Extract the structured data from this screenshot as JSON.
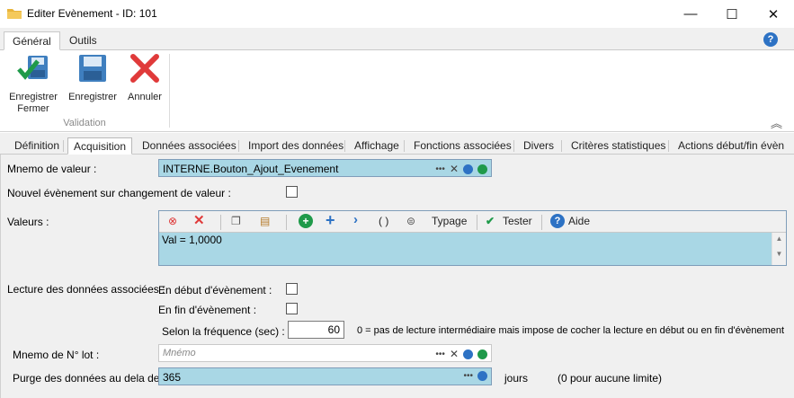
{
  "window": {
    "title": "Editer Evènement - ID: 101",
    "minimize": "—",
    "maximize": "☐",
    "close": "✕"
  },
  "ribbon_tabs": [
    "Général",
    "Outils"
  ],
  "ribbon": {
    "save_close": "Enregistrer\nFermer",
    "save": "Enregistrer",
    "cancel": "Annuler",
    "group": "Validation"
  },
  "tabs": [
    "Définition",
    "Acquisition",
    "Données associées",
    "Import des données",
    "Affichage",
    "Fonctions associées",
    "Divers",
    "Critères statistiques",
    "Actions début/fin évèn"
  ],
  "form": {
    "mnemo_label": "Mnemo de valeur :",
    "mnemo_value": "INTERNE.Bouton_Ajout_Evenement",
    "nouvel_label": "Nouvel évènement sur changement de valeur :",
    "valeurs_label": "Valeurs :",
    "valeurs_text": "Val  =  1,0000",
    "toolbar": {
      "typage": "Typage",
      "tester": "Tester",
      "aide": "Aide",
      "parens": "( )"
    },
    "lecture_label": "Lecture des données associées :",
    "debut_label": "En début d'évènement :",
    "fin_label": "En fin d'évènement :",
    "freq_label": "Selon la fréquence (sec) :",
    "freq_value": "60",
    "freq_note": "0 = pas de lecture intermédiaire mais impose de cocher la lecture en début ou en fin d'évènement",
    "lot_label": "Mnemo de N° lot :",
    "lot_placeholder": "Mnémo",
    "purge_label": "Purge des données au dela de :",
    "purge_value": "365",
    "purge_unit": "jours",
    "purge_note": "(0 pour aucune limite)"
  },
  "colors": {
    "field_bg": "#a9d7e5",
    "accent": "#2d72c4"
  }
}
